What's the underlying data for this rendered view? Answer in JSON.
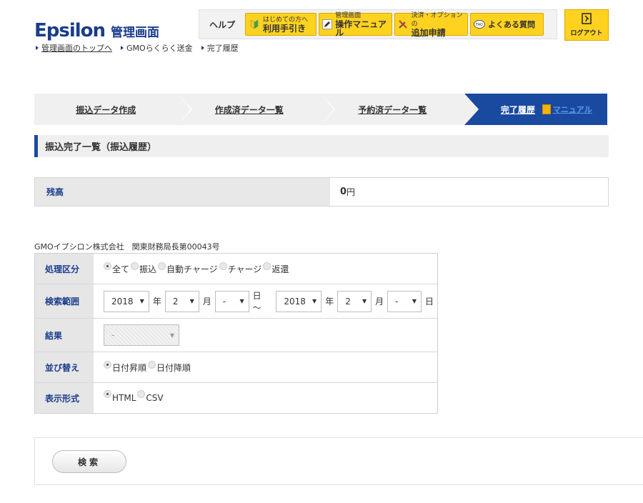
{
  "logo": {
    "en": "Epsilon",
    "ja": "管理画面"
  },
  "helpbar": {
    "label": "ヘルプ",
    "buttons": [
      {
        "small": "はじめての方へ",
        "big": "利用手引き",
        "icon": "beginner-mark-icon"
      },
      {
        "small": "管理画面",
        "big": "操作マニュアル",
        "icon": "pencil-icon"
      },
      {
        "small": "決済・オプションの",
        "big": "追加申請",
        "icon": "tools-icon"
      },
      {
        "single": "よくある質問",
        "icon": "faq-icon"
      }
    ]
  },
  "logout": {
    "label": "ログアウト"
  },
  "breadcrumb": [
    "管理画面のトップへ",
    "GMOらくらく送金",
    "完了履歴"
  ],
  "steps": [
    "振込データ作成",
    "作成済データ一覧",
    "予約済データ一覧",
    "完了履歴"
  ],
  "manual_label": "マニュアル",
  "section_title": "振込完了一覧（振込履歴）",
  "balance": {
    "label": "残高",
    "value": "0",
    "unit": "円"
  },
  "company": "GMOイプシロン株式会社　関東財務局長第00043号",
  "form": {
    "type": {
      "label": "処理区分",
      "options": [
        "全て",
        "振込",
        "自動チャージ",
        "チャージ",
        "返還"
      ],
      "selected": 0
    },
    "range": {
      "label": "検索範囲",
      "from": {
        "year": "2018",
        "month": "2",
        "day": "-"
      },
      "to": {
        "year": "2018",
        "month": "2",
        "day": "-"
      },
      "year_unit": "年",
      "month_unit": "月",
      "day_unit": "日",
      "tilde": "日 〜"
    },
    "result": {
      "label": "結果",
      "value": "-"
    },
    "sort": {
      "label": "並び替え",
      "options": [
        "日付昇順",
        "日付降順"
      ],
      "selected": 0
    },
    "format": {
      "label": "表示形式",
      "options": [
        "HTML",
        "CSV"
      ],
      "selected": 0
    }
  },
  "search_button": "検索"
}
